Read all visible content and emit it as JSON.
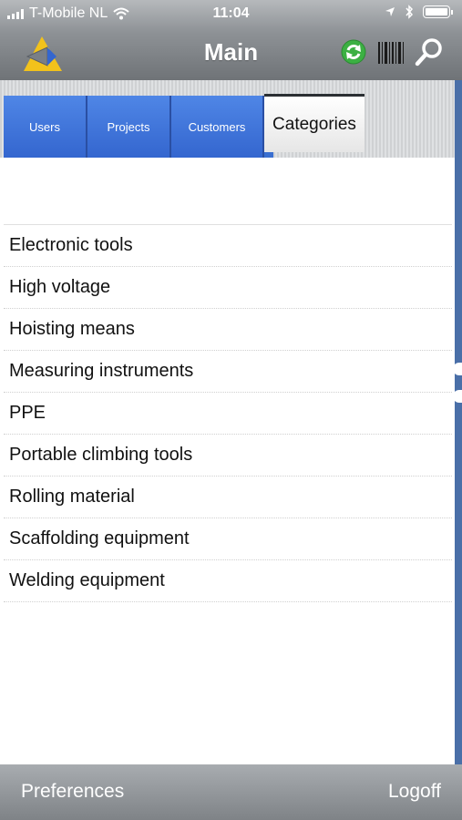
{
  "status_bar": {
    "carrier": "T-Mobile NL",
    "time": "11:04"
  },
  "nav": {
    "title": "Main"
  },
  "tabs": [
    {
      "label": "Users"
    },
    {
      "label": "Projects"
    },
    {
      "label": "Customers"
    },
    {
      "label": "Categories",
      "active": true
    }
  ],
  "categories": [
    "Electronic tools",
    "High voltage",
    "Hoisting means",
    "Measuring instruments",
    "PPE",
    "Portable climbing tools",
    "Rolling material",
    "Scaffolding equipment",
    "Welding equipment"
  ],
  "bottom": {
    "left_label": "Preferences",
    "right_label": "Logoff"
  },
  "icons": {
    "logo": "app-logo-triangle",
    "sync": "sync-icon",
    "barcode": "barcode-icon",
    "search": "search-icon"
  },
  "colors": {
    "tab_blue": "#3a6fd0",
    "sync_green": "#3cb043",
    "logo_yellow": "#f2c21b"
  }
}
